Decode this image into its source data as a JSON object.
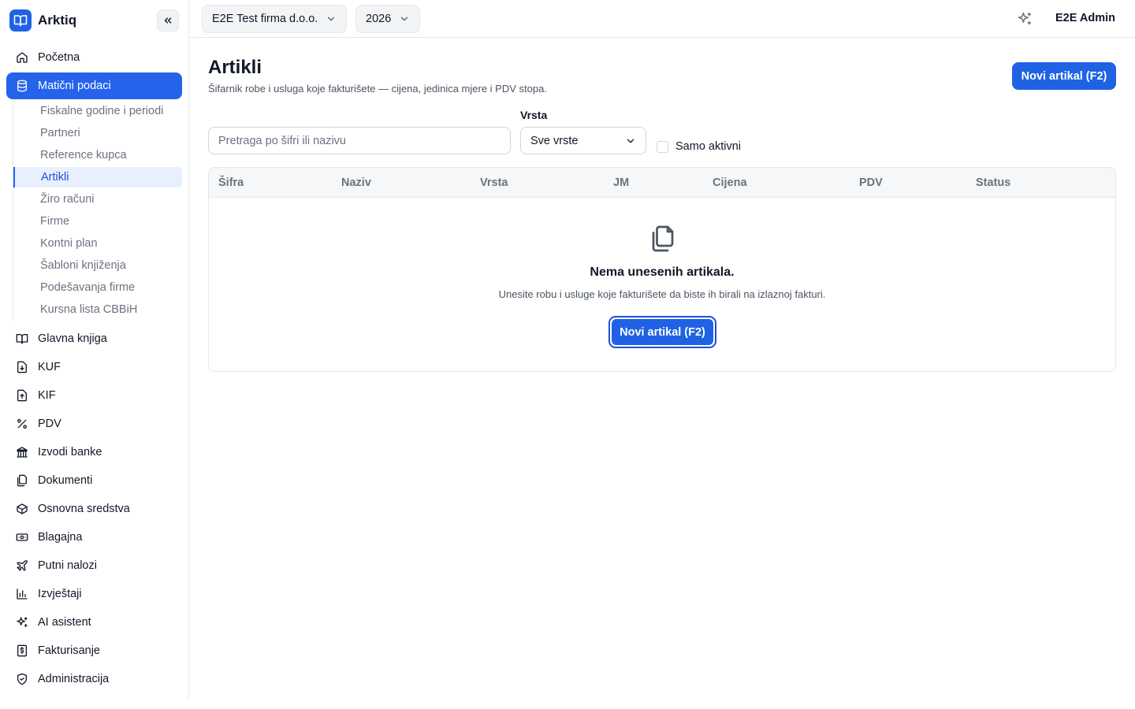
{
  "app": {
    "name": "Arktiq"
  },
  "sidebar": {
    "items": [
      {
        "label": "Početna",
        "icon": "home-icon"
      },
      {
        "label": "Matični podaci",
        "icon": "database-icon",
        "active": true
      },
      {
        "label": "Glavna knjiga",
        "icon": "book-icon"
      },
      {
        "label": "KUF",
        "icon": "file-download-icon"
      },
      {
        "label": "KIF",
        "icon": "file-upload-icon"
      },
      {
        "label": "PDV",
        "icon": "percent-icon"
      },
      {
        "label": "Izvodi banke",
        "icon": "bank-icon"
      },
      {
        "label": "Dokumenti",
        "icon": "documents-icon"
      },
      {
        "label": "Osnovna sredstva",
        "icon": "box-icon"
      },
      {
        "label": "Blagajna",
        "icon": "cash-icon"
      },
      {
        "label": "Putni nalozi",
        "icon": "plane-icon"
      },
      {
        "label": "Izvještaji",
        "icon": "bar-chart-icon"
      },
      {
        "label": "AI asistent",
        "icon": "sparkles-icon"
      },
      {
        "label": "Fakturisanje",
        "icon": "invoice-icon"
      },
      {
        "label": "Administracija",
        "icon": "shield-icon"
      }
    ],
    "subitems": [
      {
        "label": "Fiskalne godine i periodi"
      },
      {
        "label": "Partneri"
      },
      {
        "label": "Reference kupca"
      },
      {
        "label": "Artikli",
        "active": true
      },
      {
        "label": "Žiro računi"
      },
      {
        "label": "Firme"
      },
      {
        "label": "Kontni plan"
      },
      {
        "label": "Šabloni knjiženja"
      },
      {
        "label": "Podešavanja firme"
      },
      {
        "label": "Kursna lista CBBiH"
      }
    ]
  },
  "topbar": {
    "company": "E2E Test firma d.o.o.",
    "year": "2026",
    "user": "E2E Admin"
  },
  "page": {
    "title": "Artikli",
    "subtitle": "Šifarnik robe i usluga koje fakturišete — cijena, jedinica mjere i PDV stopa.",
    "new_button": "Novi artikal (F2)"
  },
  "filters": {
    "search_placeholder": "Pretraga po šifri ili nazivu",
    "type_label": "Vrsta",
    "type_value": "Sve vrste",
    "active_only_label": "Samo aktivni",
    "active_only_checked": false
  },
  "table": {
    "columns": [
      "Šifra",
      "Naziv",
      "Vrsta",
      "JM",
      "Cijena",
      "PDV",
      "Status"
    ],
    "rows": [],
    "empty_title": "Nema unesenih artikala.",
    "empty_text": "Unesite robu i usluge koje fakturišete da biste ih birali na izlaznoj fakturi.",
    "empty_button": "Novi artikal (F2)"
  },
  "colors": {
    "accent": "#1f63e4",
    "active_sub_bg": "#e8effd"
  }
}
